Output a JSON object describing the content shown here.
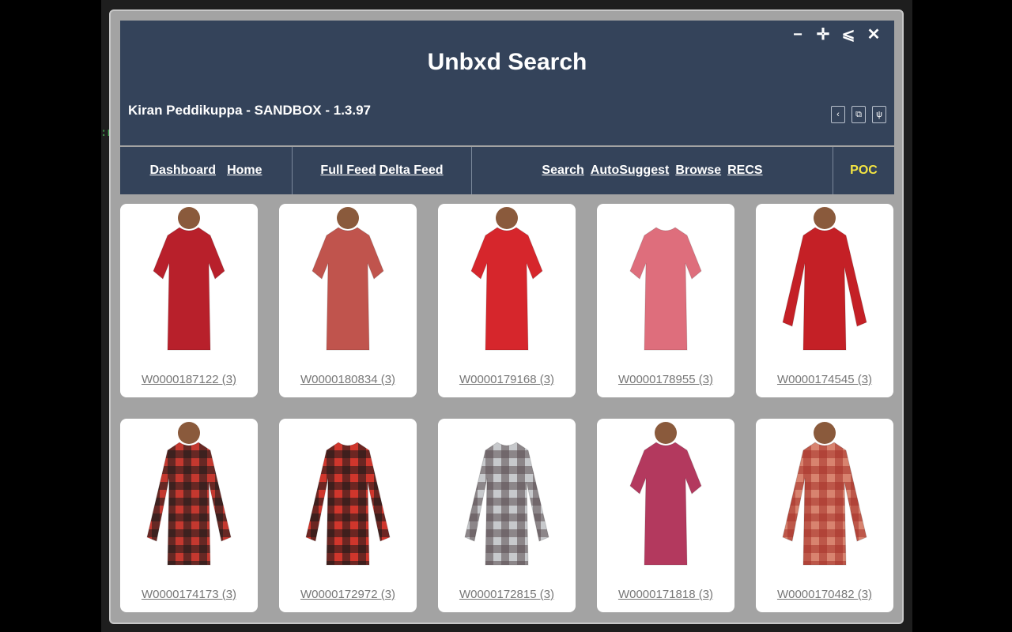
{
  "stray_text": ":n",
  "window": {
    "title": "Unbxd Search",
    "subtitle": "Kiran Peddikuppa - SANDBOX - 1.3.97",
    "controls": {
      "minimize": "−",
      "maximize": "✛",
      "menu": "⩽",
      "close": "✕"
    },
    "tools": {
      "back": "‹",
      "copy": "⧉",
      "psi": "ψ"
    }
  },
  "nav": {
    "dashboard": "Dashboard",
    "home": "Home",
    "full_feed": "Full Feed",
    "delta_feed": "Delta Feed",
    "search": "Search",
    "autosuggest": "AutoSuggest",
    "browse": "Browse",
    "recs": "RECS",
    "poc": "POC"
  },
  "colors": {
    "header_bg": "#34435a",
    "panel_bg": "#a3a3a3",
    "poc_accent": "#f4e542"
  },
  "products": [
    {
      "label": "W0000187122 (3)",
      "kind": "tshirt",
      "color": "#b8202b",
      "accent": "#8c1820"
    },
    {
      "label": "W0000180834 (3)",
      "kind": "tshirt",
      "color": "#c0544d",
      "accent": "#2b2b2b"
    },
    {
      "label": "W0000179168 (3)",
      "kind": "tshirt",
      "color": "#d6262c",
      "accent": "#2a2a2a"
    },
    {
      "label": "W0000178955 (3)",
      "kind": "tshirt",
      "color": "#de6e7c",
      "accent": "#c85a68"
    },
    {
      "label": "W0000174545 (3)",
      "kind": "longsleeve",
      "color": "#c42026",
      "accent": "#ffffff"
    },
    {
      "label": "W0000174173 (3)",
      "kind": "flannel",
      "color": "#c4382f",
      "accent": "#1c1c1c"
    },
    {
      "label": "W0000172972 (3)",
      "kind": "flannel",
      "color": "#d0362c",
      "accent": "#1a1a1a"
    },
    {
      "label": "W0000172815 (3)",
      "kind": "flannel",
      "color": "#c7c9cc",
      "accent": "#5a4f52"
    },
    {
      "label": "W0000171818 (3)",
      "kind": "tshirt",
      "color": "#b3395e",
      "accent": "#222222"
    },
    {
      "label": "W0000170482 (3)",
      "kind": "flannel",
      "color": "#d8836f",
      "accent": "#a8322a"
    }
  ]
}
